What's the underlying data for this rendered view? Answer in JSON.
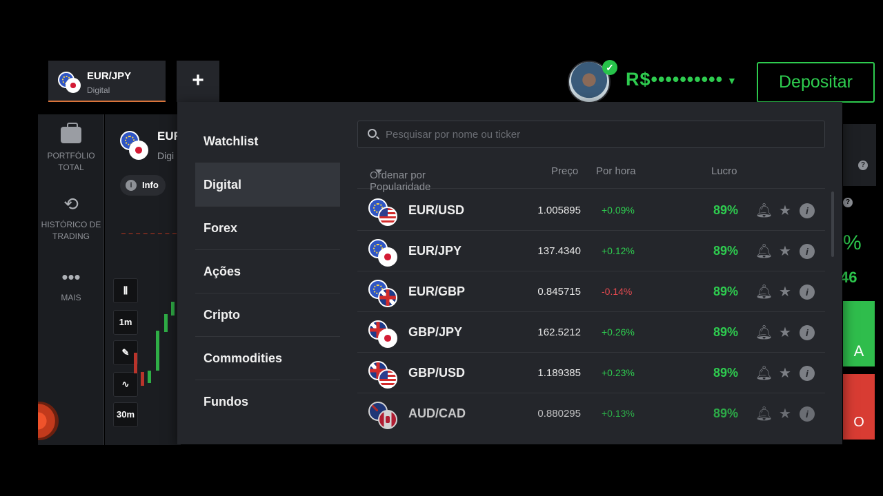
{
  "header": {
    "active_tab": {
      "name": "EUR/JPY",
      "type": "Digital"
    },
    "add_tab_label": "+",
    "balance_label": "R$••••••••••",
    "deposit_label": "Depositar"
  },
  "sidebar": {
    "items": [
      {
        "label": "PORTFÓLIO TOTAL",
        "icon": "briefcase-icon"
      },
      {
        "label": "HISTÓRICO DE TRADING",
        "icon": "history-icon"
      },
      {
        "label": "MAIS",
        "icon": "more-dots-icon"
      }
    ]
  },
  "chart": {
    "asset_short": "EUR",
    "asset_type_short": "Digi",
    "info_label": "Info",
    "tools": [
      "1m",
      "30m"
    ]
  },
  "right_panel": {
    "percent_fragment": "%",
    "number_fragment": "46",
    "green_fragment": "A",
    "red_fragment": "O"
  },
  "dropdown": {
    "categories": [
      "Watchlist",
      "Digital",
      "Forex",
      "Ações",
      "Cripto",
      "Commodities",
      "Fundos"
    ],
    "active_category": "Digital",
    "search_placeholder": "Pesquisar por nome ou ticker",
    "columns": {
      "sort": "Ordenar por Popularidade",
      "price": "Preço",
      "hourly": "Por hora",
      "profit": "Lucro"
    },
    "assets": [
      {
        "name": "EUR/USD",
        "price": "1.005895",
        "change": "+0.09%",
        "profit": "89%",
        "flags": [
          "eu",
          "us"
        ]
      },
      {
        "name": "EUR/JPY",
        "price": "137.4340",
        "change": "+0.12%",
        "profit": "89%",
        "flags": [
          "eu",
          "jp"
        ]
      },
      {
        "name": "EUR/GBP",
        "price": "0.845715",
        "change": "-0.14%",
        "profit": "89%",
        "flags": [
          "eu",
          "gb"
        ]
      },
      {
        "name": "GBP/JPY",
        "price": "162.5212",
        "change": "+0.26%",
        "profit": "89%",
        "flags": [
          "gb",
          "jp"
        ]
      },
      {
        "name": "GBP/USD",
        "price": "1.189385",
        "change": "+0.23%",
        "profit": "89%",
        "flags": [
          "gb",
          "us"
        ]
      },
      {
        "name": "AUD/CAD",
        "price": "0.880295",
        "change": "+0.13%",
        "profit": "89%",
        "flags": [
          "au",
          "ca"
        ]
      }
    ]
  },
  "colors": {
    "positive": "#2ecc4f",
    "negative": "#e0494f",
    "accent": "#d9743a"
  }
}
